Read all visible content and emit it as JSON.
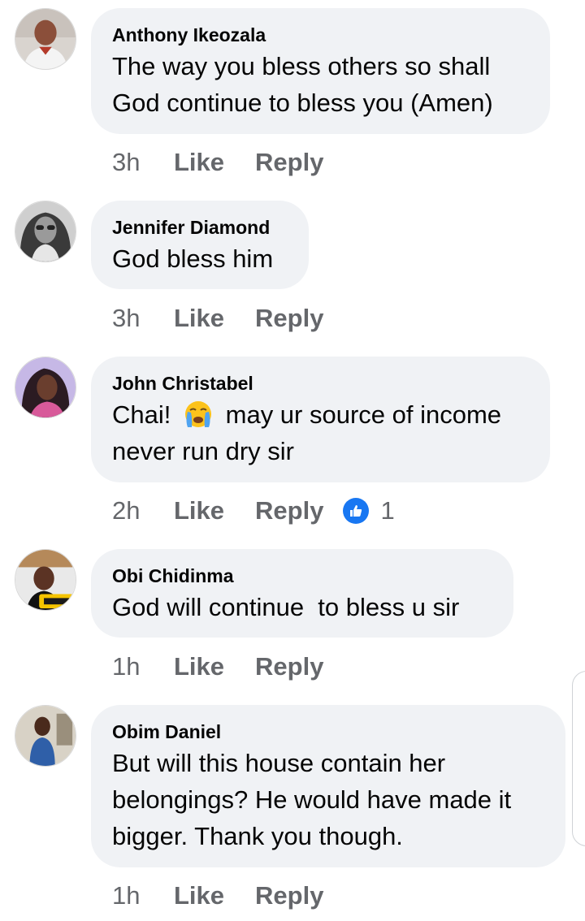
{
  "comments": [
    {
      "author": "Anthony Ikeozala",
      "lines": [
        "The way you bless others so shall",
        "God continue to bless you (Amen)"
      ],
      "time": "3h",
      "like_label": "Like",
      "reply_label": "Reply",
      "avatar_icon": "profile-photo"
    },
    {
      "author": "Jennifer Diamond",
      "lines": [
        "God bless him"
      ],
      "time": "3h",
      "like_label": "Like",
      "reply_label": "Reply",
      "avatar_icon": "profile-photo"
    },
    {
      "author": "John Christabel",
      "line1_before_emoji": "Chai!",
      "emoji": "loudly-crying-face-icon",
      "line1_after_emoji": "may ur source of income",
      "line2": "never run dry sir",
      "time": "2h",
      "like_label": "Like",
      "reply_label": "Reply",
      "reaction_count": "1",
      "reaction_icon": "thumbs-up-icon",
      "avatar_icon": "profile-photo"
    },
    {
      "author": "Obi Chidinma",
      "lines": [
        "God will continue  to bless u sir"
      ],
      "time": "1h",
      "like_label": "Like",
      "reply_label": "Reply",
      "avatar_icon": "profile-photo"
    },
    {
      "author": "Obim Daniel",
      "lines": [
        "But will this house contain her",
        "belongings? He would have made it",
        "bigger. Thank you though."
      ],
      "time": "1h",
      "like_label": "Like",
      "reply_label": "Reply",
      "avatar_icon": "profile-photo"
    }
  ],
  "colors": {
    "bubble": "#f0f2f5",
    "secondary_text": "#65676b",
    "like_badge": "#1877f2"
  }
}
